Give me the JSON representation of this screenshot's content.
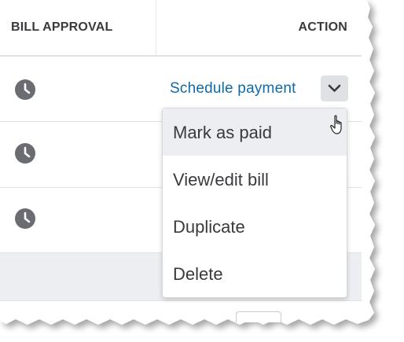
{
  "table": {
    "headers": {
      "bill_approval": "BILL APPROVAL",
      "action": "ACTION"
    },
    "rows": [
      {
        "status_icon": "clock-icon"
      },
      {
        "status_icon": "clock-icon"
      },
      {
        "status_icon": "clock-icon"
      }
    ]
  },
  "action": {
    "primary_label": "Schedule payment",
    "dropdown_icon": "chevron-down-icon"
  },
  "menu": {
    "items": [
      {
        "label": "Mark as paid",
        "hovered": true
      },
      {
        "label": "View/edit bill",
        "hovered": false
      },
      {
        "label": "Duplicate",
        "hovered": false
      },
      {
        "label": "Delete",
        "hovered": false
      }
    ]
  },
  "colors": {
    "link": "#0f6aa8",
    "header_text": "#393a3d",
    "icon": "#6b6c72",
    "hover_bg": "#eceef1",
    "divider": "#dfe1e5"
  }
}
